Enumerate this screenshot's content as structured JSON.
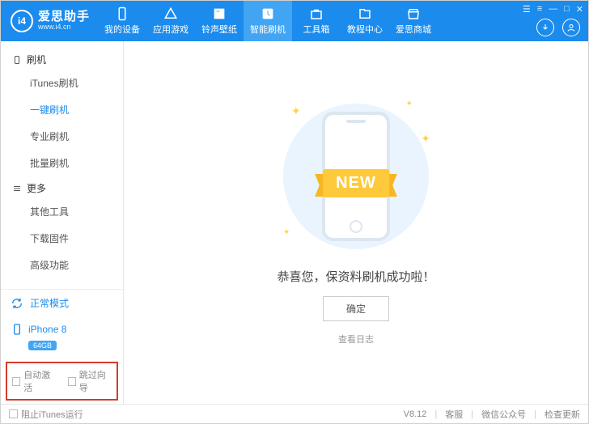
{
  "brand": {
    "title": "爱思助手",
    "subtitle": "www.i4.cn",
    "badge": "i4"
  },
  "window": {
    "history": "☰",
    "settings": "≡",
    "min": "—",
    "max": "□",
    "close": "✕"
  },
  "nav": [
    {
      "label": "我的设备"
    },
    {
      "label": "应用游戏"
    },
    {
      "label": "铃声壁纸"
    },
    {
      "label": "智能刷机"
    },
    {
      "label": "工具箱"
    },
    {
      "label": "教程中心"
    },
    {
      "label": "爱思商城"
    }
  ],
  "sidebar": {
    "group1": {
      "title": "刷机",
      "items": [
        "iTunes刷机",
        "一键刷机",
        "专业刷机",
        "批量刷机"
      ]
    },
    "group2": {
      "title": "更多",
      "items": [
        "其他工具",
        "下载固件",
        "高级功能"
      ]
    },
    "mode": "正常模式",
    "device": {
      "name": "iPhone 8",
      "storage": "64GB"
    },
    "checks": {
      "auto_activate": "自动激活",
      "skip_guide": "跳过向导"
    }
  },
  "main": {
    "ribbon": "NEW",
    "success": "恭喜您，保资料刷机成功啦！",
    "ok": "确定",
    "view_log": "查看日志"
  },
  "footer": {
    "block_itunes": "阻止iTunes运行",
    "version": "V8.12",
    "support": "客服",
    "wechat": "微信公众号",
    "update": "检查更新"
  }
}
